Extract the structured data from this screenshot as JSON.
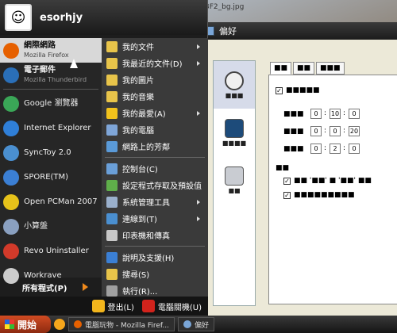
{
  "desktop": {
    "top_file": "3F2_bg.jpg"
  },
  "start_menu": {
    "username": "esorhjy",
    "pinned": [
      {
        "label": "網際網路",
        "sub": "Mozilla Firefox",
        "icon": "firefox-icon",
        "color": "#e66000"
      },
      {
        "label": "電子郵件",
        "sub": "Mozilla Thunderbird",
        "icon": "thunderbird-icon",
        "color": "#2a6fb8"
      }
    ],
    "recent": [
      {
        "label": "Google 瀏覽器",
        "icon": "chrome-icon",
        "color": "#3aa757"
      },
      {
        "label": "Internet Explorer",
        "icon": "ie-icon",
        "color": "#2f7fd8"
      },
      {
        "label": "SyncToy 2.0",
        "icon": "synctoy-icon",
        "color": "#4a8fd0"
      },
      {
        "label": "SPORE(TM)",
        "icon": "spore-icon",
        "color": "#3b7fd4"
      },
      {
        "label": "Open PCMan 2007",
        "icon": "pcman-icon",
        "color": "#e6c21a"
      },
      {
        "label": "小算盤",
        "icon": "calculator-icon",
        "color": "#8aa0c0"
      },
      {
        "label": "Revo Uninstaller",
        "icon": "revo-icon",
        "color": "#d23a2a"
      },
      {
        "label": "Workrave",
        "icon": "workrave-icon",
        "color": "#cccccc"
      }
    ],
    "all_programs": "所有程式(P)",
    "right_items": [
      {
        "label": "我的文件",
        "icon": "folder-icon",
        "color": "#e8c44a",
        "arrow": true
      },
      {
        "label": "我最近的文件(D)",
        "icon": "recent-docs-icon",
        "color": "#e8c44a",
        "arrow": true
      },
      {
        "label": "我的圖片",
        "icon": "pictures-icon",
        "color": "#e8c44a",
        "arrow": false
      },
      {
        "label": "我的音樂",
        "icon": "music-icon",
        "color": "#e8c44a",
        "arrow": false
      },
      {
        "label": "我的最愛(A)",
        "icon": "star-icon",
        "color": "#f2c21c",
        "arrow": true
      },
      {
        "label": "我的電腦",
        "icon": "computer-icon",
        "color": "#7fa6d8",
        "arrow": false
      },
      {
        "label": "網路上的芳鄰",
        "icon": "network-icon",
        "color": "#5a9ad8",
        "arrow": false
      },
      {
        "label": "控制台(C)",
        "icon": "control-panel-icon",
        "color": "#6a9fd8",
        "arrow": false
      },
      {
        "label": "設定程式存取及預設值",
        "icon": "program-access-icon",
        "color": "#5fae4a",
        "arrow": false
      },
      {
        "label": "系統管理工具",
        "icon": "admin-tools-icon",
        "color": "#9ab0cc",
        "arrow": true
      },
      {
        "label": "連線到(T)",
        "icon": "connect-icon",
        "color": "#4a8fd0",
        "arrow": true
      },
      {
        "label": "印表機和傳真",
        "icon": "printer-icon",
        "color": "#c8c8c8",
        "arrow": false
      },
      {
        "label": "說明及支援(H)",
        "icon": "help-icon",
        "color": "#3b7fd4",
        "arrow": false
      },
      {
        "label": "搜尋(S)",
        "icon": "search-icon",
        "color": "#e8c44a",
        "arrow": false
      },
      {
        "label": "執行(R)...",
        "icon": "run-icon",
        "color": "#a0a0a0",
        "arrow": false
      }
    ],
    "logoff": "登出(L)",
    "shutdown": "電腦關機(U)"
  },
  "prefs_window": {
    "title": "偏好",
    "categories": [
      "■■■",
      "■■■■",
      "■■"
    ],
    "tabs": [
      "■■",
      "■■",
      "■■■"
    ],
    "options": {
      "top_check": "■■■■■",
      "rows": [
        {
          "label": "■■■",
          "h": "0",
          "m": "10",
          "s": "0"
        },
        {
          "label": "■■■",
          "h": "0",
          "m": "0",
          "s": "20"
        },
        {
          "label": "■■■",
          "h": "0",
          "m": "2",
          "s": "0"
        }
      ],
      "section": "■■",
      "check2": "■■ '■■' ■ '■■' ■■",
      "check3": "■■■■■■■■■"
    }
  },
  "taskbar": {
    "start": "開始",
    "tasks": [
      "電腦玩物 - Mozilla Firef...",
      "偏好"
    ]
  }
}
